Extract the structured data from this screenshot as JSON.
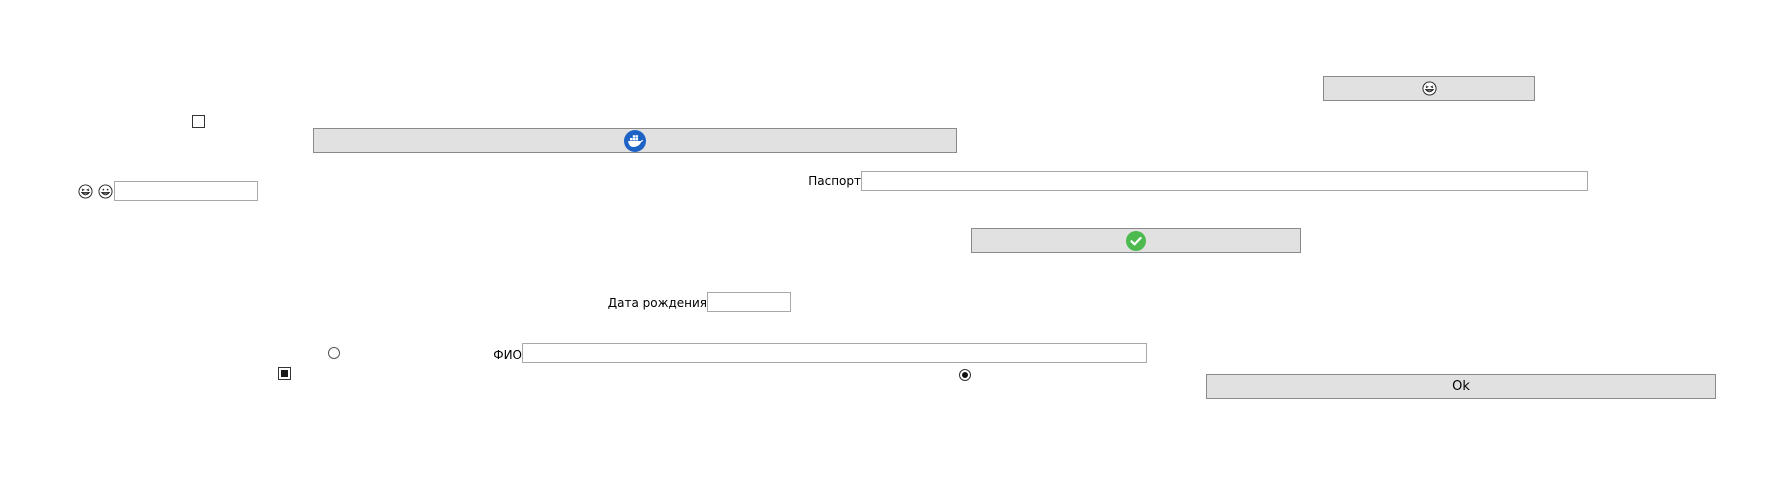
{
  "buttons": {
    "emoji_button_icon": "grinning-squint-face-icon",
    "docker_button_icon": "docker-whale-icon",
    "check_button_icon": "check-circle-icon",
    "ok_label": "Ok"
  },
  "fields": {
    "passport_label": "Паспорт",
    "passport_value": "",
    "birthdate_label": "Дата рождения",
    "birthdate_value": "",
    "fio_label": "ФИО",
    "fio_value": "",
    "left_input_value": ""
  },
  "emoji_icons": [
    "grinning-squint-face-icon",
    "grinning-face-icon"
  ],
  "checkboxes": {
    "top_checked": false,
    "bottom_checked": true
  },
  "radios": {
    "left_checked": false,
    "right_checked": true
  },
  "colors": {
    "button_bg": "#e1e1e1",
    "docker_blue": "#1d63c6",
    "check_green": "#4cba4f"
  }
}
